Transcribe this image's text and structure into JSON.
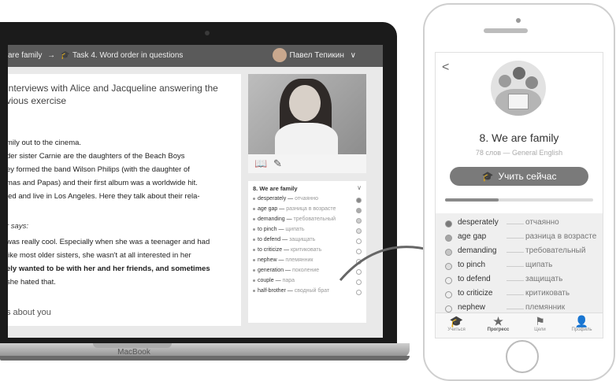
{
  "laptop": {
    "breadcrumb_part1": "are family",
    "breadcrumb_sep": "→",
    "breadcrumb_icon": "graduation-cap-icon",
    "breadcrumb_part2": "Task 4. Word order in questions",
    "user_name": "Павел Тепикин",
    "user_chevron": "∨",
    "brand": "MacBook",
    "lesson_title": "interviews with Alice and Jacqueline answering the vious exercise",
    "paragraph": [
      "mily out to the cinema.",
      "der sister Carnie are the daughters of the Beach Boys",
      "ey formed the band Wilson Philips (with the daughter of",
      "mas and Papas) and their first album was a worldwide hit.",
      "ied and live in Los Angeles. Here they talk about their rela-"
    ],
    "says_label": "r says:",
    "quote": [
      "was really cool. Especially when she was a teenager and had",
      "like most older sisters, she wasn't at all interested in her",
      "ely wanted to be with her and her friends, and sometimes",
      "she hated that."
    ],
    "bottom_text": "s about you",
    "word_panel_title": "8. We are family",
    "words": [
      {
        "word": "desperately",
        "translation": "отчаянно"
      },
      {
        "word": "age gap",
        "translation": "разница в возрасте"
      },
      {
        "word": "demanding",
        "translation": "требовательный"
      },
      {
        "word": "to pinch",
        "translation": "щипать"
      },
      {
        "word": "to defend",
        "translation": "защищать"
      },
      {
        "word": "to criticize",
        "translation": "критиковать"
      },
      {
        "word": "nephew",
        "translation": "племянник"
      },
      {
        "word": "generation",
        "translation": "поколение"
      },
      {
        "word": "couple",
        "translation": "пара"
      },
      {
        "word": "half-brother",
        "translation": "сводный брат"
      }
    ]
  },
  "phone": {
    "back": "<",
    "title": "8. We are family",
    "subtitle": "78 слов — General English",
    "button_label": "Учить сейчас",
    "progress": 0.36,
    "words": [
      {
        "word": "desperately",
        "translation": "отчаянно"
      },
      {
        "word": "age gap",
        "translation": "разница в возрасте"
      },
      {
        "word": "demanding",
        "translation": "требовательный"
      },
      {
        "word": "to pinch",
        "translation": "щипать"
      },
      {
        "word": "to defend",
        "translation": "защищать"
      },
      {
        "word": "to criticize",
        "translation": "критиковать"
      },
      {
        "word": "nephew",
        "translation": "племянник"
      }
    ],
    "nav": [
      {
        "label": "Учиться",
        "icon": "graduation-cap-icon"
      },
      {
        "label": "Прогресс",
        "icon": "star-icon"
      },
      {
        "label": "Цели",
        "icon": "flag-icon"
      },
      {
        "label": "Профиль",
        "icon": "user-icon"
      }
    ]
  }
}
